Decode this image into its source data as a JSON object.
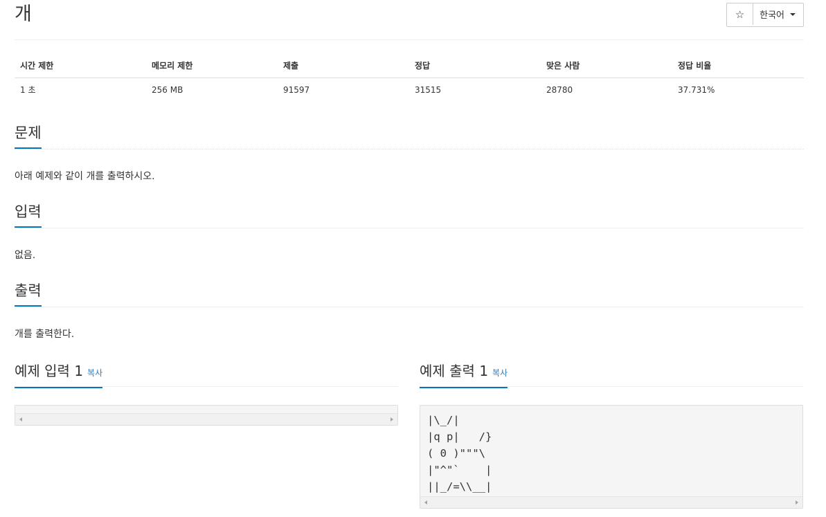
{
  "problem": {
    "title": "개",
    "star_icon": "☆",
    "language": "한국어"
  },
  "stats": {
    "headers": [
      "시간 제한",
      "메모리 제한",
      "제출",
      "정답",
      "맞은 사람",
      "정답 비율"
    ],
    "values": [
      "1 초",
      "256 MB",
      "91597",
      "31515",
      "28780",
      "37.731%"
    ]
  },
  "sections": {
    "description": {
      "heading": "문제",
      "text": "아래 예제와 같이 개를 출력하시오."
    },
    "input": {
      "heading": "입력",
      "text": "없음."
    },
    "output": {
      "heading": "출력",
      "text": "개를 출력한다."
    }
  },
  "samples": {
    "input": {
      "heading": "예제 입력 1",
      "copy": "복사",
      "content": ""
    },
    "output": {
      "heading": "예제 출력 1",
      "copy": "복사",
      "content": "|\\_/|\n|q p|   /}\n( 0 )\"\"\"\\\n|\"^\"`    |\n||_/=\\\\__|"
    }
  }
}
